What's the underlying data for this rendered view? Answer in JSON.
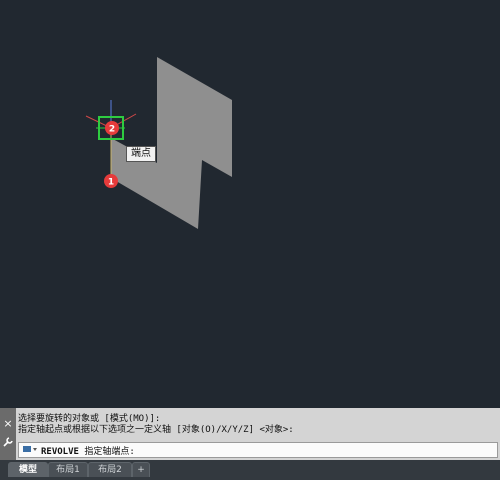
{
  "viewport": {
    "tooltip": "端点",
    "markers": [
      {
        "label": "2",
        "color": "#e63b3b"
      },
      {
        "label": "1",
        "color": "#e63b3b"
      }
    ]
  },
  "command": {
    "history_line1": "选择要旋转的对象或 [模式(MO)]:",
    "history_line2": "指定轴起点或根据以下选项之一定义轴 [对象(O)/X/Y/Z] <对象>:",
    "prompt_cmd": "REVOLVE",
    "prompt_text": "指定轴端点:",
    "close_icon": "×",
    "wrench_icon": "wrench"
  },
  "tabs": [
    {
      "label": "模型",
      "active": true
    },
    {
      "label": "布局1",
      "active": false
    },
    {
      "label": "布局2",
      "active": false
    },
    {
      "label": "+",
      "active": false
    }
  ],
  "colors": {
    "background": "#212830",
    "shape": "#8f8f8f",
    "snap": "#2ecc40",
    "marker": "#e63b3b"
  }
}
